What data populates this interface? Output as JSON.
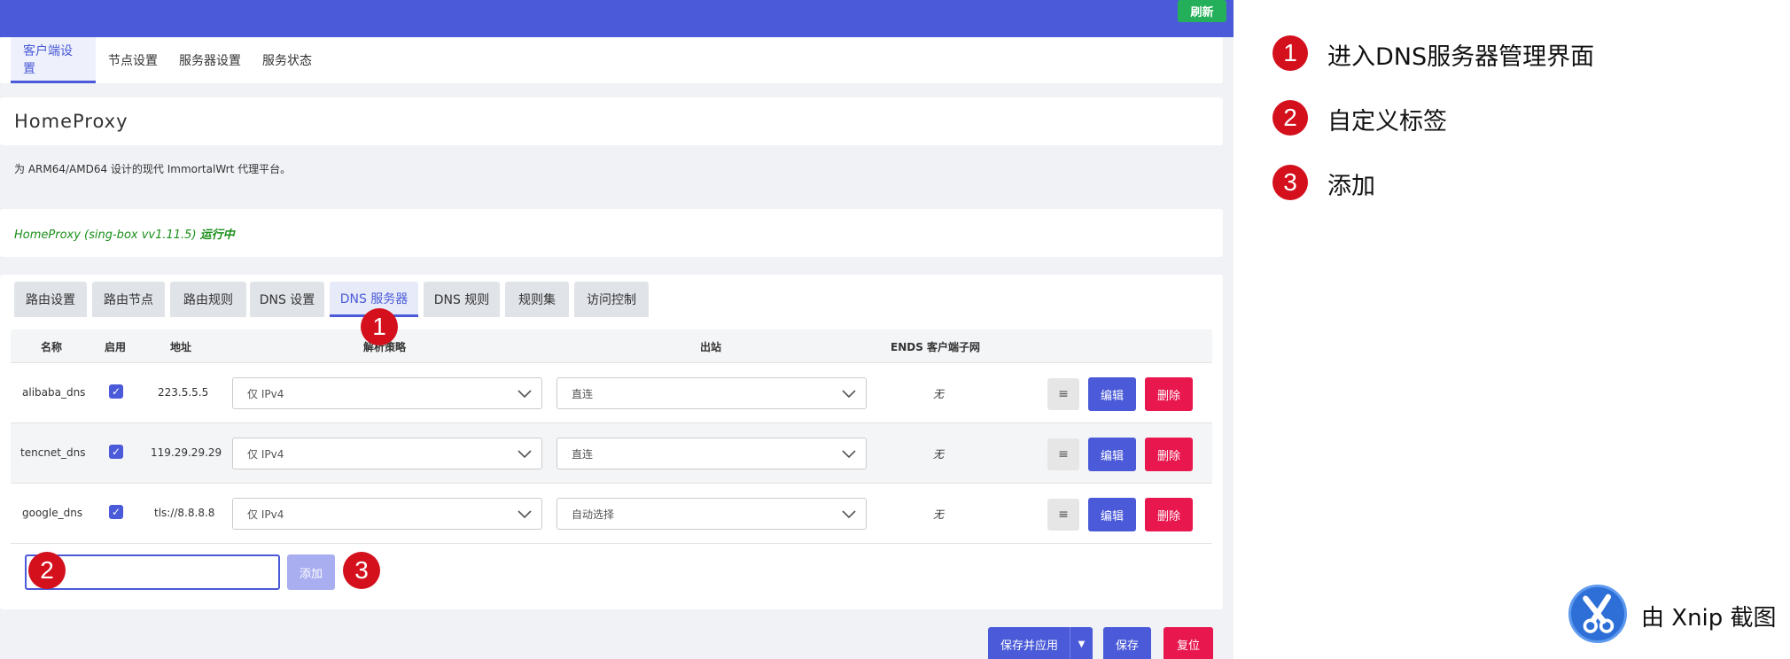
{
  "header": {
    "refresh_label": "刷新"
  },
  "nav": {
    "tabs": [
      "客户端设置",
      "节点设置",
      "服务器设置",
      "服务状态"
    ]
  },
  "app": {
    "title": "HomeProxy",
    "description": "为 ARM64/AMD64 设计的现代 ImmortalWrt 代理平台。",
    "status_prefix": "HomeProxy (sing-box vv1.11.5) ",
    "status_state": "运行中"
  },
  "subtabs": [
    "路由设置",
    "路由节点",
    "路由规则",
    "DNS 设置",
    "DNS 服务器",
    "DNS 规则",
    "规则集",
    "访问控制"
  ],
  "table": {
    "headers": [
      "名称",
      "启用",
      "地址",
      "解析策略",
      "出站",
      "ENDS 客户端子网"
    ],
    "rows": [
      {
        "name": "alibaba_dns",
        "enabled": "✓",
        "address": "223.5.5.5",
        "strategy": "仅 IPv4",
        "outbound": "直连",
        "ecs": "无"
      },
      {
        "name": "tencnet_dns",
        "enabled": "✓",
        "address": "119.29.29.29",
        "strategy": "仅 IPv4",
        "outbound": "直连",
        "ecs": "无"
      },
      {
        "name": "google_dns",
        "enabled": "✓",
        "address": "tls://8.8.8.8",
        "strategy": "仅 IPv4",
        "outbound": "自动选择",
        "ecs": "无"
      }
    ],
    "menu_label": "≡",
    "edit_label": "编辑",
    "delete_label": "删除",
    "add_label": "添加"
  },
  "actions": {
    "save_apply": "保存并应用",
    "save": "保存",
    "reset": "复位"
  },
  "markers": [
    "1",
    "2",
    "3"
  ],
  "legend": [
    {
      "num": "1",
      "text": "进入DNS服务器管理界面"
    },
    {
      "num": "2",
      "text": "自定义标签"
    },
    {
      "num": "3",
      "text": "添加"
    }
  ],
  "watermark": {
    "text": "由 Xnip 截图"
  },
  "colors": {
    "accent": "#4a5ad8",
    "danger": "#e8184f",
    "success": "#24b05a",
    "marker": "#d4101d"
  }
}
